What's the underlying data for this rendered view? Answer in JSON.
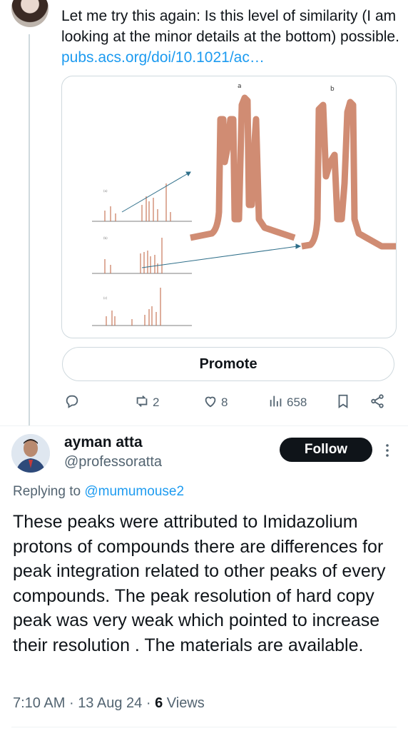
{
  "tweet": {
    "text": "Let me try this again: Is this level of similarity (I am looking at the minor details at the bottom) possible.",
    "link_text": "pubs.acs.org/doi/10.1021/ac…",
    "image": {
      "label_a": "a",
      "label_b": "b"
    },
    "promote_label": "Promote",
    "actions": {
      "reply_count": "",
      "retweet_count": "2",
      "like_count": "8",
      "views_count": "658"
    }
  },
  "reply": {
    "name": "ayman atta",
    "handle": "@professoratta",
    "follow_label": "Follow",
    "replying_prefix": "Replying to",
    "replying_to": "@mumumouse2",
    "text": "These peaks were attributed to Imidazolium protons of compounds there are differences for peak integration related to other peaks of every compounds. The peak resolution of hard copy peak was very weak which pointed to increase their resolution . The materials are available.",
    "time": "7:10 AM",
    "date": "13 Aug 24",
    "views_count": "6",
    "views_label": "Views"
  },
  "colors": {
    "accent": "#1d9bf0",
    "text": "#0f1419",
    "muted": "#536471",
    "border": "#cfd9de",
    "spectrum": "#c8785a"
  }
}
